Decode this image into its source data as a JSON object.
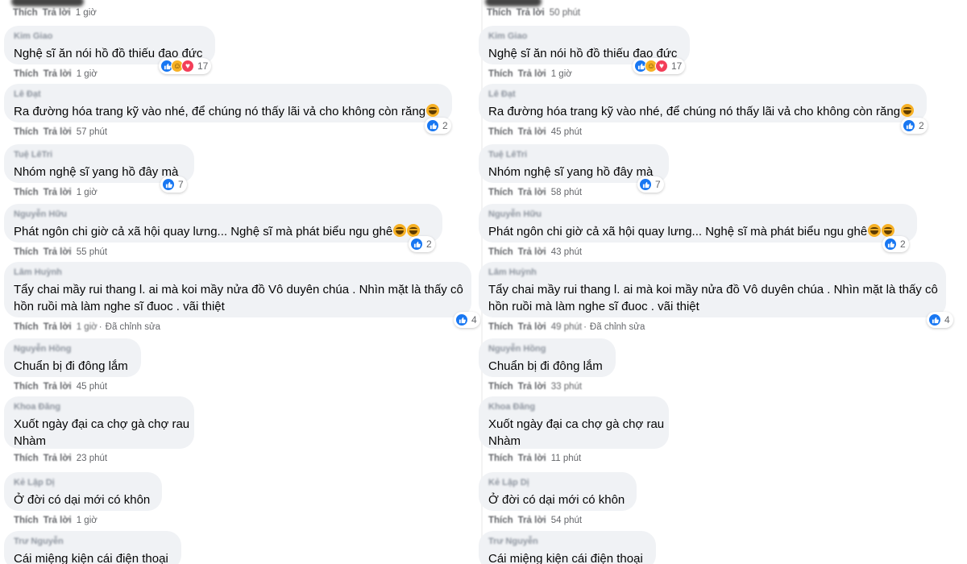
{
  "labels": {
    "like": "Thích",
    "reply": "Trả lời",
    "edited": "Đã chỉnh sửa"
  },
  "left": {
    "header_time": "1 giờ",
    "comments": [
      {
        "author": "Kim Giao",
        "lines": [
          "Nghệ sĩ ăn nói hồ đồ thiếu đạo đức"
        ],
        "time": "1 giờ",
        "reactions": [
          "like",
          "haha",
          "love"
        ],
        "count": "17"
      },
      {
        "author": "Lê Đạt",
        "lines": [
          "Ra đường hóa trang kỹ vào nhé, để chúng nó thấy lãi vả cho không còn răng"
        ],
        "emoji": 1,
        "time": "57 phút",
        "reactions": [
          "like"
        ],
        "count": "2"
      },
      {
        "author": "Tuệ LêTri",
        "lines": [
          "Nhóm nghệ sĩ yang hồ đây mà"
        ],
        "time": "1 giờ",
        "reactions": [
          "like"
        ],
        "count": "7"
      },
      {
        "author": "Nguyễn Hữu",
        "lines": [
          "Phát ngôn chi giờ cả xã hội quay lưng... Nghệ sĩ mà phát biểu ngu ghê"
        ],
        "emoji": 2,
        "time": "55 phút",
        "reactions": [
          "like"
        ],
        "count": "2"
      },
      {
        "author": "Lâm Huỳnh",
        "lines": [
          "Tẩy chai mầy rui thang l. ai mà koi mầy nửa đồ Vô duyên chúa . Nhìn mặt là thấy cô",
          "hồn ruồi mà làm nghe sĩ đuoc . vãi thiệt"
        ],
        "time": "1 giờ",
        "edited": true,
        "reactions": [
          "like"
        ],
        "count": "4"
      },
      {
        "author": "Nguyễn Hồng",
        "lines": [
          "Chuẩn bị đi đông lắm"
        ],
        "time": "45 phút"
      },
      {
        "author": "Khoa Đăng",
        "lines": [
          "Xuốt ngày đại ca chợ gà chợ rau",
          "Nhàm"
        ],
        "time": "23 phút"
      },
      {
        "author": "Kẻ Lập Dị",
        "lines": [
          "Ở đời có dại mới có khôn"
        ],
        "time": "1 giờ"
      },
      {
        "author": "Trư Nguyễn",
        "lines": [
          "Cái miệng kiện cái điện thoại"
        ]
      }
    ]
  },
  "right": {
    "header_time": "50 phút",
    "comments": [
      {
        "author": "Kim Giao",
        "lines": [
          "Nghệ sĩ ăn nói hồ đồ thiếu đạo đức"
        ],
        "time": "1 giờ",
        "reactions": [
          "like",
          "haha",
          "love"
        ],
        "count": "17"
      },
      {
        "author": "Lê Đạt",
        "lines": [
          "Ra đường hóa trang kỹ vào nhé, để chúng nó thấy lãi vả cho không còn răng"
        ],
        "emoji": 1,
        "time": "45 phút",
        "reactions": [
          "like"
        ],
        "count": "2"
      },
      {
        "author": "Tuệ LêTri",
        "lines": [
          "Nhóm nghệ sĩ yang hồ đây mà"
        ],
        "time": "58 phút",
        "reactions": [
          "like"
        ],
        "count": "7"
      },
      {
        "author": "Nguyễn Hữu",
        "lines": [
          "Phát ngôn chi giờ cả xã hội quay lưng... Nghệ sĩ mà phát biểu ngu ghê"
        ],
        "emoji": 2,
        "time": "43 phút",
        "reactions": [
          "like"
        ],
        "count": "2"
      },
      {
        "author": "Lâm Huỳnh",
        "lines": [
          "Tẩy chai mầy rui thang l. ai mà koi mầy nửa đồ Vô duyên chúa . Nhìn mặt là thấy cô",
          "hồn ruồi mà làm nghe sĩ đuoc . vãi thiệt"
        ],
        "time": "49 phút",
        "edited": true,
        "reactions": [
          "like"
        ],
        "count": "4"
      },
      {
        "author": "Nguyễn Hồng",
        "lines": [
          "Chuẩn bị đi đông lắm"
        ],
        "time": "33 phút"
      },
      {
        "author": "Khoa Đăng",
        "lines": [
          "Xuốt ngày đại ca chợ gà chợ rau",
          "Nhàm"
        ],
        "time": "11 phút"
      },
      {
        "author": "Kẻ Lập Dị",
        "lines": [
          "Ở đời có dại mới có khôn"
        ],
        "time": "54 phút"
      },
      {
        "author": "Trư Nguyễn",
        "lines": [
          "Cái miệng kiện cái điện thoại"
        ]
      }
    ]
  }
}
